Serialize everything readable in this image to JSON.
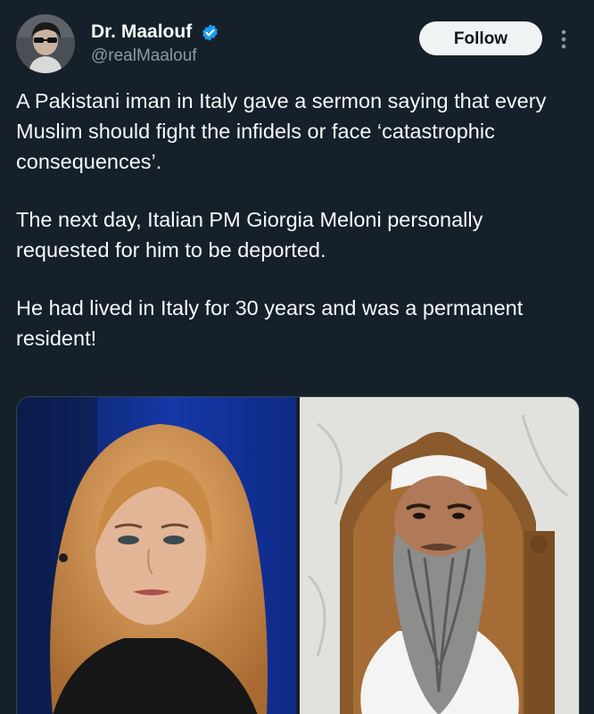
{
  "author": {
    "display_name": "Dr. Maalouf",
    "handle": "@realMaalouf",
    "verified": true
  },
  "actions": {
    "follow_label": "Follow",
    "more_icon": "more-vertical-icon"
  },
  "tweet": {
    "paragraphs": [
      "A Pakistani iman in Italy gave a sermon saying that every Muslim should fight the infidels or face ‘catastrophic consequences’.",
      "The next day, Italian PM Giorgia Meloni personally requested for him to be deported.",
      "He had lived in Italy for 30 years and was a permanent resident!"
    ]
  },
  "media": {
    "count": 2
  },
  "colors": {
    "background": "#15202b",
    "text": "#f7f9f9",
    "muted": "#8b98a5",
    "verified": "#1d9bf0",
    "follow_bg": "#eff3f4"
  }
}
